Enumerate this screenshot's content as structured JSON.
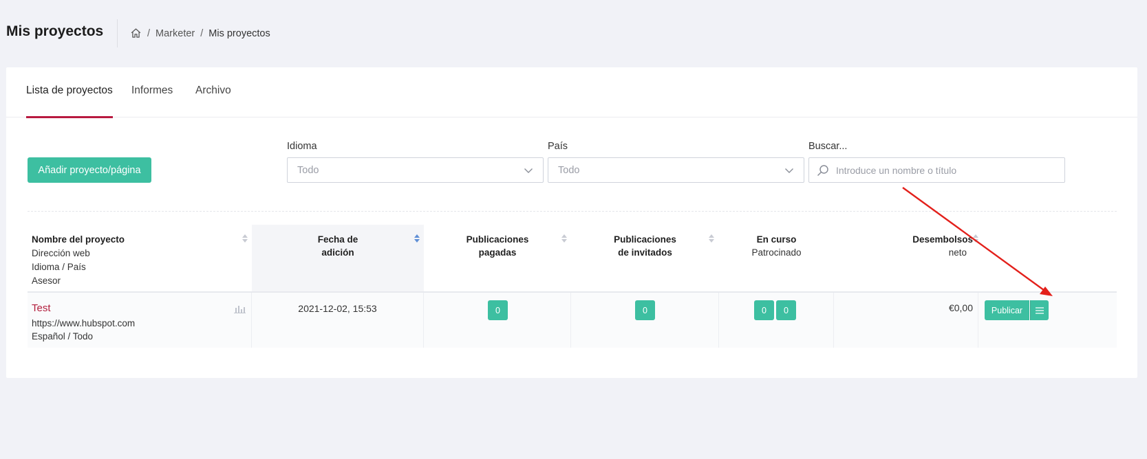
{
  "header": {
    "title": "Mis proyectos",
    "breadcrumb": {
      "home_icon": "home-icon",
      "section": "Marketer",
      "current": "Mis proyectos",
      "separator": "/"
    }
  },
  "tabs": [
    {
      "label": "Lista de proyectos",
      "active": true
    },
    {
      "label": "Informes",
      "active": false
    },
    {
      "label": "Archivo",
      "active": false
    }
  ],
  "toolbar": {
    "add_button": "Añadir proyecto/página",
    "language": {
      "label": "Idioma",
      "value": "Todo"
    },
    "country": {
      "label": "País",
      "value": "Todo"
    },
    "search": {
      "label": "Buscar...",
      "placeholder": "Introduce un nombre o título"
    }
  },
  "table": {
    "columns": {
      "name": {
        "title": "Nombre del proyecto",
        "sub": [
          "Dirección web",
          "Idioma / País",
          "Asesor"
        ]
      },
      "date": {
        "title1": "Fecha de",
        "title2": "adición"
      },
      "paid": {
        "title1": "Publicaciones",
        "title2": "pagadas"
      },
      "guest": {
        "title1": "Publicaciones",
        "title2": "de invitados"
      },
      "ongoing": {
        "title": "En curso",
        "sub": "Patrocinado"
      },
      "payout": {
        "title": "Desembolsos",
        "sub": "neto"
      }
    },
    "rows": [
      {
        "name": "Test",
        "url": "https://www.hubspot.com",
        "lang_country": "Español / Todo",
        "date": "2021-12-02, 15:53",
        "paid": "0",
        "guest": "0",
        "ongoing_a": "0",
        "ongoing_b": "0",
        "payout": "€0,00",
        "publish_label": "Publicar"
      }
    ]
  },
  "colors": {
    "accent": "#3dbfa1",
    "tab_underline": "#b8193f",
    "link": "#b21d3c",
    "annotation_arrow": "#e3201b"
  }
}
